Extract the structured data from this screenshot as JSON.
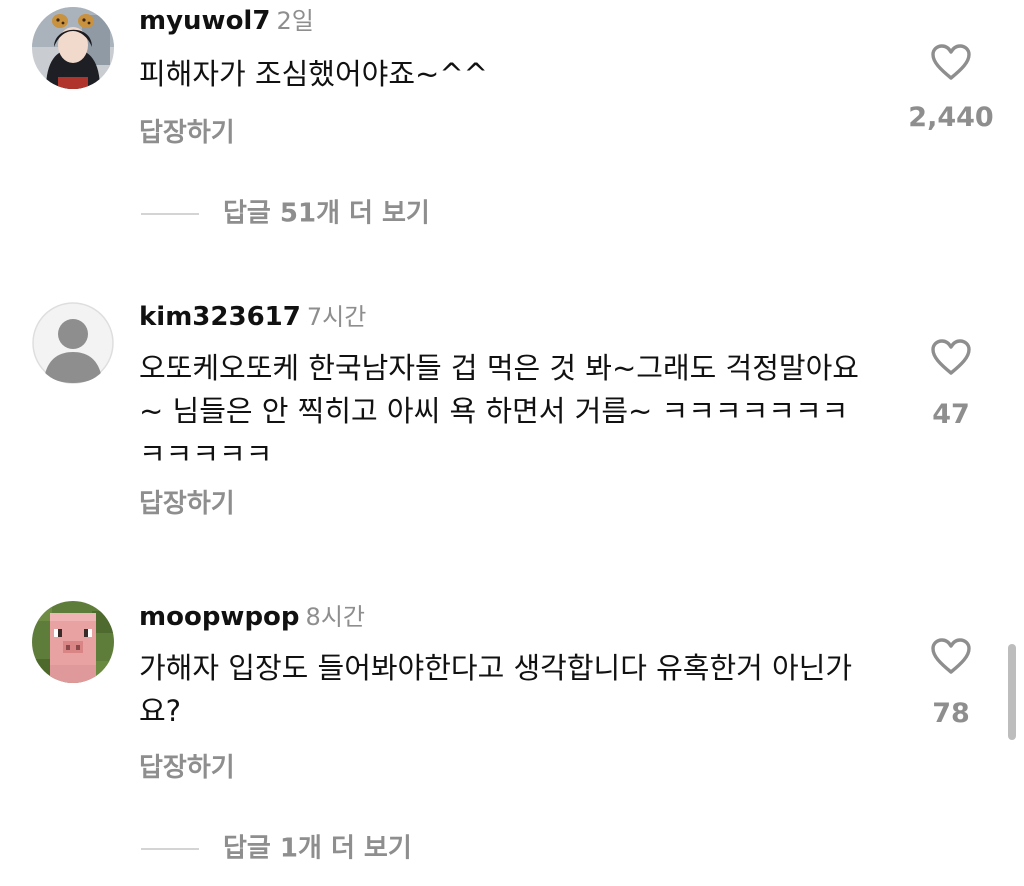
{
  "comments": [
    {
      "username": "myuwol7",
      "time": "2일",
      "text": "피해자가 조심했어야죠~^^",
      "reply_label": "답장하기",
      "like_count": "2,440",
      "view_replies": "답글 51개 더 보기"
    },
    {
      "username": "kim323617",
      "time": "7시간",
      "text": "오또케오또케 한국남자들 겁 먹은 것 봐~그래도 걱정말아요~ 님들은 안 찍히고 아씨 욕 하면서 거름~ ㅋㅋㅋㅋㅋㅋㅋㅋㅋㅋㅋㅋ",
      "reply_label": "답장하기",
      "like_count": "47"
    },
    {
      "username": "moopwpop",
      "time": "8시간",
      "text": "가해자 입장도 들어봐야한다고 생각합니다 유혹한거 아닌가요?",
      "reply_label": "답장하기",
      "like_count": "78",
      "view_replies": "답글 1개 더 보기"
    }
  ],
  "icons": {
    "like": "heart-outline-icon",
    "default_avatar": "default-profile-icon"
  },
  "colors": {
    "text": "#111111",
    "secondary": "#8e8e8e",
    "divider": "#d4d4d4"
  }
}
